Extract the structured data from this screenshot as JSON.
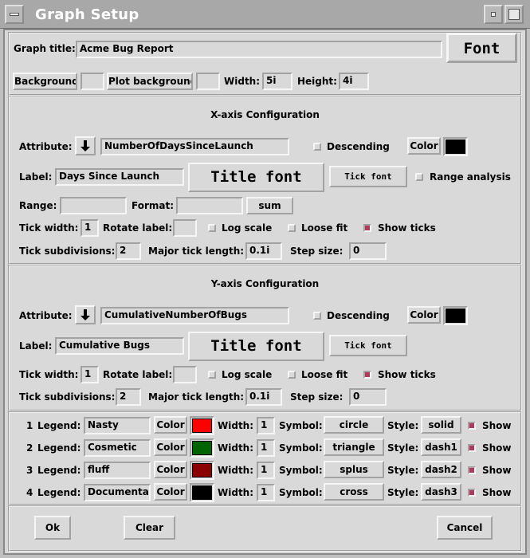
{
  "window": {
    "title": "Graph Setup"
  },
  "general": {
    "graph_title_label": "Graph title:",
    "graph_title_value": "Acme Bug Report",
    "font_button": "Font",
    "background_button": "Background",
    "plot_background_button": "Plot background",
    "width_label": "Width:",
    "width_value": "5i",
    "height_label": "Height:",
    "height_value": "4i"
  },
  "xaxis": {
    "header": "X-axis Configuration",
    "attribute_label": "Attribute:",
    "attribute_value": "NumberOfDaysSinceLaunch",
    "descending_label": "Descending",
    "color_button": "Color",
    "label_label": "Label:",
    "label_value": "Days Since Launch",
    "title_font_button": "Title font",
    "tick_font_button": "Tick font",
    "range_analysis_label": "Range analysis",
    "range_label": "Range:",
    "range_value": "",
    "format_label": "Format:",
    "format_value": "",
    "sum_button": "sum",
    "tick_width_label": "Tick width:",
    "tick_width_value": "1",
    "rotate_label_label": "Rotate label:",
    "rotate_label_value": "",
    "log_scale_label": "Log scale",
    "loose_fit_label": "Loose fit",
    "show_ticks_label": "Show ticks",
    "tick_subdivisions_label": "Tick subdivisions:",
    "tick_subdivisions_value": "2",
    "major_tick_length_label": "Major tick length:",
    "major_tick_length_value": "0.1i",
    "step_size_label": "Step size:",
    "step_size_value": "0"
  },
  "yaxis": {
    "header": "Y-axis Configuration",
    "attribute_label": "Attribute:",
    "attribute_value": "CumulativeNumberOfBugs",
    "descending_label": "Descending",
    "color_button": "Color",
    "label_label": "Label:",
    "label_value": "Cumulative Bugs",
    "title_font_button": "Title font",
    "tick_font_button": "Tick font",
    "tick_width_label": "Tick width:",
    "tick_width_value": "1",
    "rotate_label_label": "Rotate label:",
    "rotate_label_value": "",
    "log_scale_label": "Log scale",
    "loose_fit_label": "Loose fit",
    "show_ticks_label": "Show ticks",
    "tick_subdivisions_label": "Tick subdivisions:",
    "tick_subdivisions_value": "2",
    "major_tick_length_label": "Major tick length:",
    "major_tick_length_value": "0.1i",
    "step_size_label": "Step size:",
    "step_size_value": "0"
  },
  "legend_labels": {
    "legend": "Legend:",
    "color": "Color",
    "width": "Width:",
    "symbol": "Symbol:",
    "style": "Style:",
    "show": "Show"
  },
  "legends": [
    {
      "index": "1",
      "name": "Nasty",
      "color": "#ff0000",
      "width": "1",
      "symbol": "circle",
      "style": "solid"
    },
    {
      "index": "2",
      "name": "Cosmetic",
      "color": "#006400",
      "width": "1",
      "symbol": "triangle",
      "style": "dash1"
    },
    {
      "index": "3",
      "name": "fluff",
      "color": "#8b0000",
      "width": "1",
      "symbol": "splus",
      "style": "dash2"
    },
    {
      "index": "4",
      "name": "Documentati",
      "color": "#000000",
      "width": "1",
      "symbol": "cross",
      "style": "dash3"
    }
  ],
  "axis_colors": {
    "x": "#000000",
    "y": "#000000"
  },
  "state": {
    "x_descending": false,
    "x_range_analysis": false,
    "x_log_scale": false,
    "x_loose_fit": false,
    "x_show_ticks": true,
    "y_descending": false,
    "y_log_scale": false,
    "y_loose_fit": false,
    "y_show_ticks": true,
    "legend_show": [
      true,
      true,
      true,
      true
    ]
  },
  "footer": {
    "ok_button": "Ok",
    "clear_button": "Clear",
    "cancel_button": "Cancel"
  },
  "icons": [
    "window-menu-icon",
    "minimize-icon",
    "maximize-icon",
    "down-arrow-icon"
  ]
}
